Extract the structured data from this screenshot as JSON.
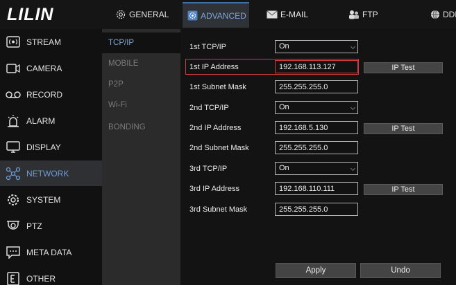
{
  "brand": {
    "name": "LILIN"
  },
  "tabs": [
    {
      "label": "GENERAL",
      "icon": "gear-icon"
    },
    {
      "label": "ADVANCED",
      "icon": "advanced-icon",
      "active": true
    },
    {
      "label": "E-MAIL",
      "icon": "envelope-icon"
    },
    {
      "label": "FTP",
      "icon": "ftp-icon"
    },
    {
      "label": "DDNS",
      "icon": "globe-icon"
    }
  ],
  "sidebar": {
    "items": [
      {
        "label": "STREAM",
        "icon": "stream-icon"
      },
      {
        "label": "CAMERA",
        "icon": "camera-icon"
      },
      {
        "label": "RECORD",
        "icon": "record-icon"
      },
      {
        "label": "ALARM",
        "icon": "alarm-icon"
      },
      {
        "label": "DISPLAY",
        "icon": "display-icon"
      },
      {
        "label": "NETWORK",
        "icon": "network-icon",
        "active": true
      },
      {
        "label": "SYSTEM",
        "icon": "system-icon"
      },
      {
        "label": "PTZ",
        "icon": "ptz-icon"
      },
      {
        "label": "META DATA",
        "icon": "metadata-icon"
      },
      {
        "label": "OTHER",
        "icon": "other-icon"
      }
    ]
  },
  "subnav": {
    "items": [
      {
        "label": "TCP/IP",
        "active": true
      },
      {
        "label": "MOBILE"
      },
      {
        "label": "P2P"
      },
      {
        "label": "Wi-Fi"
      },
      {
        "label": "BONDING"
      }
    ]
  },
  "form": {
    "rows": [
      {
        "label": "1st TCP/IP",
        "value": "On"
      },
      {
        "label": "1st IP Address",
        "value": "192.168.113.127",
        "button": "IP Test"
      },
      {
        "label": "1st Subnet Mask",
        "value": "255.255.255.0"
      },
      {
        "label": "2nd TCP/IP",
        "value": "On"
      },
      {
        "label": "2nd IP Address",
        "value": "192.168.5.130",
        "button": "IP Test"
      },
      {
        "label": "2nd Subnet Mask",
        "value": "255.255.255.0"
      },
      {
        "label": "3rd TCP/IP",
        "value": "On"
      },
      {
        "label": "3rd IP Address",
        "value": "192.168.110.111",
        "button": "IP Test"
      },
      {
        "label": "3rd Subnet Mask",
        "value": "255.255.255.0"
      }
    ],
    "apply_label": "Apply",
    "undo_label": "Undo"
  },
  "colors": {
    "accent": "#6f9bd6",
    "highlight": "#d63a3a"
  }
}
